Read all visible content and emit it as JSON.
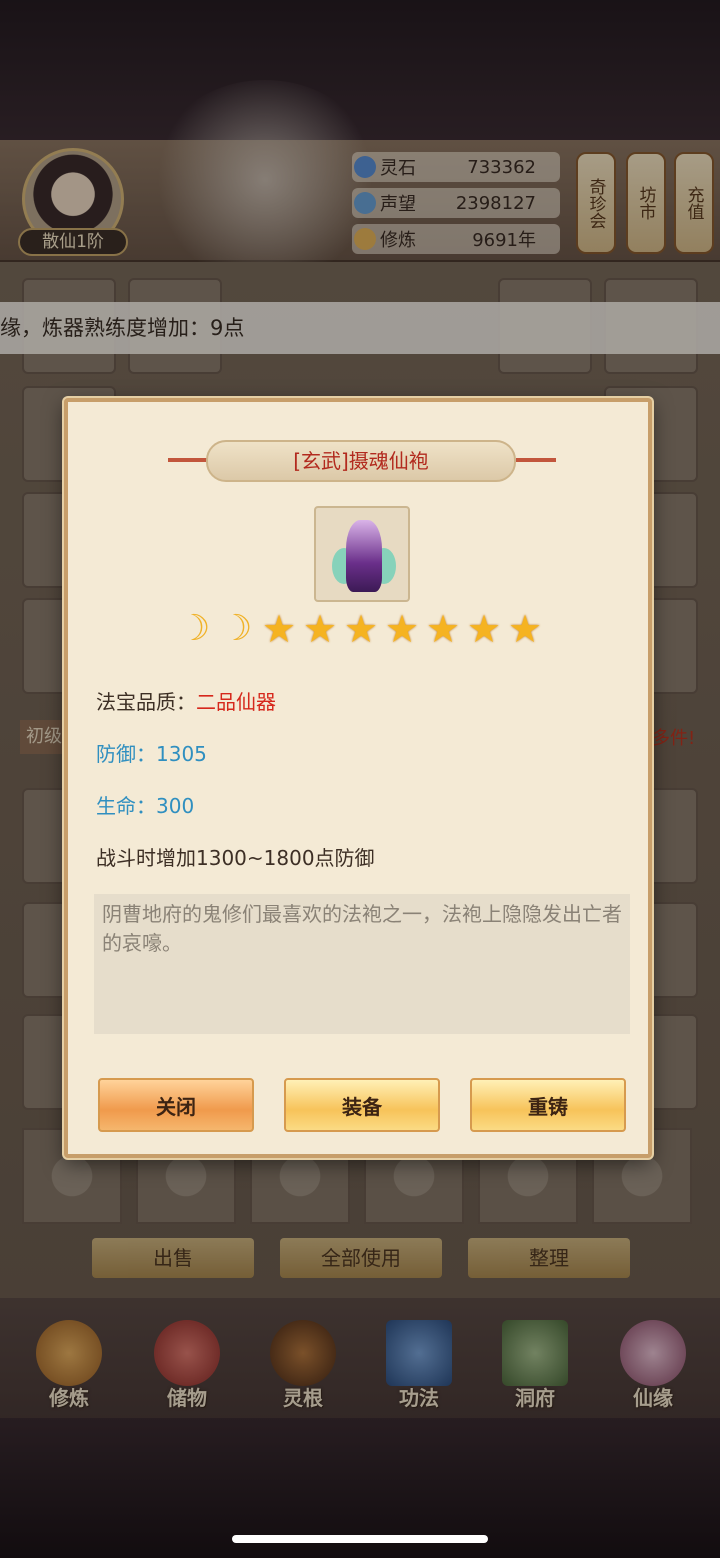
{
  "header": {
    "rank_label": "散仙1阶",
    "resources": [
      {
        "label": "灵石",
        "value": "733362",
        "icon": "spirit-stone-icon",
        "color": "#5b8fd6"
      },
      {
        "label": "声望",
        "value": "2398127",
        "icon": "prestige-icon",
        "color": "#6aa2d8"
      },
      {
        "label": "修炼",
        "value": "9691年",
        "icon": "cultivation-icon",
        "color": "#e7b55a"
      }
    ],
    "side_buttons": [
      "奇珍会",
      "坊市",
      "充值"
    ]
  },
  "toast": {
    "text": "缘，炼器熟练度增加：9点"
  },
  "inventory": {
    "bottom_actions": [
      "出售",
      "全部使用",
      "整理"
    ],
    "side_texts": {
      "left": "初级",
      "right": "多件!"
    }
  },
  "nav": {
    "items": [
      {
        "label": "修炼",
        "icon": "cultivation-nav-icon",
        "color": "#c98a3c"
      },
      {
        "label": "储物",
        "icon": "storage-bag-icon",
        "color": "#c0504a"
      },
      {
        "label": "灵根",
        "icon": "spirit-root-icon",
        "color": "#7a4a2a"
      },
      {
        "label": "功法",
        "icon": "technique-book-icon",
        "color": "#3e6ea8"
      },
      {
        "label": "洞府",
        "icon": "cave-dwelling-icon",
        "color": "#6b8a5a"
      },
      {
        "label": "仙缘",
        "icon": "immortal-fate-icon",
        "color": "#b36b8a"
      }
    ]
  },
  "dialog": {
    "title": "[玄武]摄魂仙袍",
    "item_icon": "robe-item-icon",
    "rating": {
      "moons": 2,
      "stars": 7
    },
    "quality_label": "法宝品质：",
    "quality_value": "二品仙器",
    "quality_color": "#d6281c",
    "defense": "防御：1305",
    "hp": "生命：300",
    "attr_color": "#2f8fc0",
    "effect": "战斗时增加1300~1800点防御",
    "description": "阴曹地府的鬼修们最喜欢的法袍之一，法袍上隐隐发出亡者的哀嚎。",
    "buttons": {
      "close": "关闭",
      "equip": "装备",
      "recast": "重铸"
    }
  }
}
